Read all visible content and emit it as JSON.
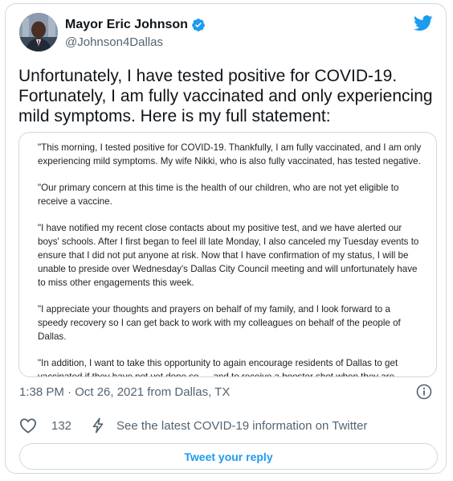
{
  "author": {
    "name": "Mayor Eric Johnson",
    "handle": "@Johnson4Dallas",
    "verified": true
  },
  "tweet": {
    "text": "Unfortunately, I have tested positive for COVID-19. Fortunately, I am fully vaccinated and only experiencing mild symptoms. Here is my full statement:"
  },
  "statement": {
    "paragraphs": [
      "\"This morning, I tested positive for COVID-19. Thankfully, I am fully vaccinated, and I am only experiencing mild symptoms. My wife Nikki, who is also fully vaccinated, has tested negative.",
      "\"Our primary concern at this time is the health of our children, who are not yet eligible to receive a vaccine.",
      "\"I have notified my recent close contacts about my positive test, and we have alerted our boys' schools. After I first began to feel ill late Monday, I also canceled my Tuesday events to ensure that I did not put anyone at risk. Now that I have confirmation of my status, I will be unable to preside over Wednesday's Dallas City Council meeting and will unfortunately have to miss other engagements this week.",
      "\"I appreciate your thoughts and prayers on behalf of my family, and I look forward to a speedy recovery so I can get back to work with my colleagues on behalf of the people of Dallas.",
      "\"In addition, I want to take this opportunity to again encourage residents of Dallas to get vaccinated if they have not yet done so — and to receive a booster shot when they are eligible. The vaccines have saved lives and can make breakthrough cases, like mine, far less severe.\""
    ]
  },
  "meta": {
    "timestamp": "1:38 PM · Oct 26, 2021 from Dallas, TX"
  },
  "actions": {
    "like_count": "132",
    "covid_info": "See the latest COVID-19 information on Twitter"
  },
  "reply_button": "Tweet your reply",
  "colors": {
    "accent": "#1d9bf0",
    "text": "#0f1419",
    "secondary": "#536471",
    "border": "#cfd9de"
  },
  "icons": [
    "verified-badge-icon",
    "twitter-bird-icon",
    "info-icon",
    "heart-icon",
    "lightning-icon"
  ]
}
